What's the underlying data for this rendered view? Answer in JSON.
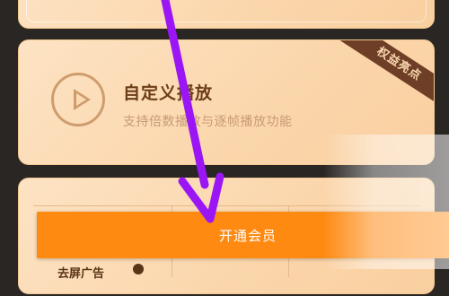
{
  "feature_card": {
    "badge": "权益亮点",
    "title": "自定义播放",
    "description": "支持倍数播放与逐帧播放功能",
    "icon": "play-circle-icon"
  },
  "cta": {
    "label": "开通会员"
  },
  "comparison_table": {
    "first_row_label": "去屏广告"
  },
  "overlay": {
    "arrow_color": "#9b16f5",
    "arrow_icon": "purple-annotation-arrow"
  },
  "colors": {
    "accent": "#ff8a12",
    "card_background": "#fbd7ad",
    "badge_background": "#6e3f26",
    "title_text": "#6b3d17"
  }
}
